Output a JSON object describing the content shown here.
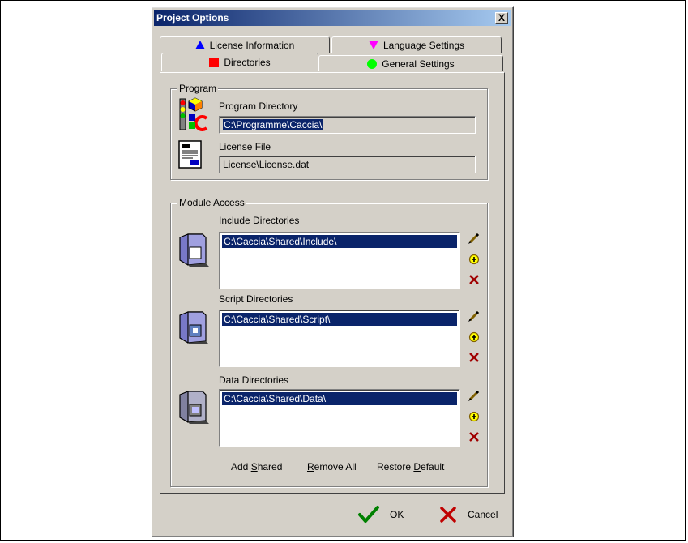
{
  "dialog": {
    "title": "Project Options",
    "close_label": "X"
  },
  "tabs": {
    "license": "License Information",
    "language": "Language Settings",
    "directories": "Directories",
    "general": "General Settings"
  },
  "program": {
    "group_title": "Program",
    "program_dir_label": "Program Directory",
    "program_dir_value": "C:\\Programme\\Caccia\\",
    "license_file_label": "License File",
    "license_file_value": "License\\License.dat"
  },
  "module_access": {
    "group_title": "Module Access",
    "include": {
      "label": "Include Directories",
      "items": [
        "C:\\Caccia\\Shared\\Include\\"
      ]
    },
    "script": {
      "label": "Script Directories",
      "items": [
        "C:\\Caccia\\Shared\\Script\\"
      ]
    },
    "data": {
      "label": "Data Directories",
      "items": [
        "C:\\Caccia\\Shared\\Data\\"
      ]
    },
    "add_shared": {
      "pre": "Add ",
      "key": "S",
      "post": "hared"
    },
    "remove_all": {
      "pre": "",
      "key": "R",
      "post": "emove All"
    },
    "restore_default": {
      "pre": "Restore ",
      "key": "D",
      "post": "efault"
    }
  },
  "footer": {
    "ok_label": "OK",
    "cancel_label": "Cancel"
  },
  "colors": {
    "title_bar": "#0a246a",
    "selection": "#0a246a",
    "face": "#d4d0c8",
    "tab_license_icon": "#0000ff",
    "tab_language_icon": "#ff00ff",
    "tab_directories_icon": "#ff0000",
    "tab_general_icon": "#00ff00",
    "ok_check": "#008000",
    "cancel_x": "#c00000"
  },
  "icons": {
    "tab_license": "triangle-up-icon",
    "tab_language": "triangle-down-icon",
    "tab_directories": "square-icon",
    "tab_general": "circle-icon",
    "program": "program-shapes-icon",
    "license": "document-icon",
    "include": "folder-include-icon",
    "script": "folder-script-icon",
    "data": "folder-data-icon",
    "edit": "pencil-icon",
    "add": "plus-icon",
    "delete": "delete-x-icon",
    "ok": "checkmark-icon",
    "cancel": "cancel-x-icon"
  }
}
